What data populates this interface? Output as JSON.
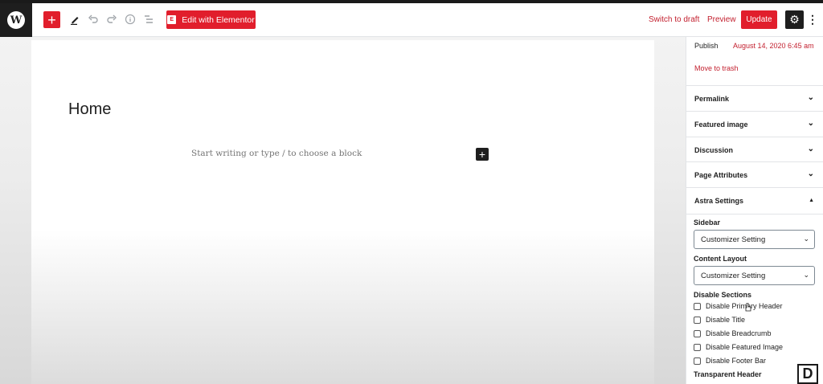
{
  "toolbar": {
    "add_label": "+",
    "elementor_badge": "E",
    "elementor_label": "Edit with Elementor",
    "switch_draft_label": "Switch to draft",
    "preview_label": "Preview",
    "update_label": "Update",
    "icons": [
      "wordpress-logo",
      "add-block-icon",
      "edit-pencil-icon",
      "undo-icon",
      "redo-icon",
      "info-icon",
      "list-view-icon",
      "gear-icon",
      "more-options-icon"
    ]
  },
  "editor": {
    "page_title": "Home",
    "placeholder": "Start writing or type / to choose a block"
  },
  "sidebar": {
    "publish_label": "Publish",
    "publish_date": "August 14, 2020 6:45 am",
    "trash_label": "Move to trash",
    "panels": [
      {
        "label": "Permalink"
      },
      {
        "label": "Featured image"
      },
      {
        "label": "Discussion"
      },
      {
        "label": "Page Attributes"
      },
      {
        "label": "Astra Settings"
      }
    ],
    "astra": {
      "sidebar_label": "Sidebar",
      "sidebar_value": "Customizer Setting",
      "content_layout_label": "Content Layout",
      "content_layout_value": "Customizer Setting",
      "disable_sections_label": "Disable Sections",
      "checkboxes": [
        {
          "label": "Disable Primary Header"
        },
        {
          "label": "Disable Title"
        },
        {
          "label": "Disable Breadcrumb"
        },
        {
          "label": "Disable Featured Image"
        },
        {
          "label": "Disable Footer Bar"
        }
      ],
      "transparent_header_label": "Transparent Header"
    }
  },
  "watermark": {
    "letter": "D"
  },
  "colors": {
    "accent": "#e11e2c",
    "link": "#c3202f",
    "dark": "#1e1e1e"
  }
}
